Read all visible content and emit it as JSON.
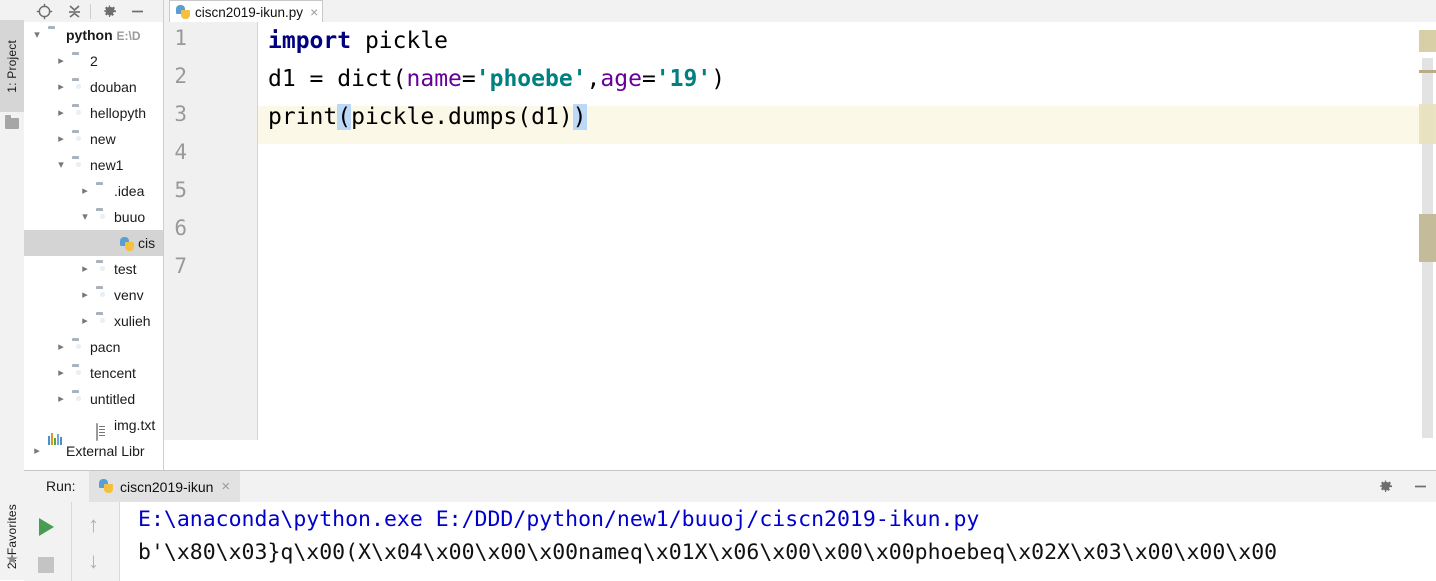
{
  "app": "PyCharm",
  "left_tool_strip": {
    "project_tab": {
      "label": "1: Project",
      "underline": "1",
      "icon": "folder-icon"
    },
    "favorites_tab": {
      "label": "2: Favorites",
      "underline": "2",
      "icon": "star-icon"
    }
  },
  "project_panel": {
    "toolbar": [
      {
        "name": "locate-icon",
        "title": "Select Opened File"
      },
      {
        "name": "collapse-all-icon",
        "title": "Collapse All"
      },
      {
        "name": "gear-icon",
        "title": "Settings"
      },
      {
        "name": "minimize-icon",
        "title": "Hide"
      }
    ],
    "tree": [
      {
        "label": "python",
        "detail": "E:\\D",
        "icon": "folder-icon",
        "depth": 0,
        "arrow": "down",
        "bold": true,
        "selected": false
      },
      {
        "label": "2",
        "detail": "",
        "icon": "folder-icon",
        "depth": 1,
        "arrow": "right",
        "bold": false,
        "selected": false
      },
      {
        "label": "douban",
        "detail": "",
        "icon": "folder-open-icon",
        "depth": 1,
        "arrow": "right",
        "bold": false,
        "selected": false
      },
      {
        "label": "hellopyth",
        "detail": "",
        "icon": "folder-open-icon",
        "depth": 1,
        "arrow": "right",
        "bold": false,
        "selected": false
      },
      {
        "label": "new",
        "detail": "",
        "icon": "folder-open-icon",
        "depth": 1,
        "arrow": "right",
        "bold": false,
        "selected": false
      },
      {
        "label": "new1",
        "detail": "",
        "icon": "folder-open-icon",
        "depth": 1,
        "arrow": "down",
        "bold": false,
        "selected": false
      },
      {
        "label": ".idea",
        "detail": "",
        "icon": "folder-icon",
        "depth": 2,
        "arrow": "right",
        "bold": false,
        "selected": false
      },
      {
        "label": "buuo",
        "detail": "",
        "icon": "folder-open-icon",
        "depth": 2,
        "arrow": "down",
        "bold": false,
        "selected": false
      },
      {
        "label": "cis",
        "detail": "",
        "icon": "python-file-icon",
        "depth": 3,
        "arrow": "",
        "bold": false,
        "selected": true
      },
      {
        "label": "test",
        "detail": "",
        "icon": "folder-open-icon",
        "depth": 2,
        "arrow": "right",
        "bold": false,
        "selected": false
      },
      {
        "label": "venv",
        "detail": "",
        "icon": "folder-open-icon",
        "depth": 2,
        "arrow": "right",
        "bold": false,
        "selected": false
      },
      {
        "label": "xulieh",
        "detail": "",
        "icon": "folder-open-icon",
        "depth": 2,
        "arrow": "right",
        "bold": false,
        "selected": false
      },
      {
        "label": "pacn",
        "detail": "",
        "icon": "folder-open-icon",
        "depth": 1,
        "arrow": "right",
        "bold": false,
        "selected": false
      },
      {
        "label": "tencent",
        "detail": "",
        "icon": "folder-open-icon",
        "depth": 1,
        "arrow": "right",
        "bold": false,
        "selected": false
      },
      {
        "label": "untitled",
        "detail": "",
        "icon": "folder-open-icon",
        "depth": 1,
        "arrow": "right",
        "bold": false,
        "selected": false
      },
      {
        "label": "img.txt",
        "detail": "",
        "icon": "text-file-icon",
        "depth": 2,
        "arrow": "",
        "bold": false,
        "selected": false
      },
      {
        "label": "External Libr",
        "detail": "",
        "icon": "library-icon",
        "depth": 0,
        "arrow": "right",
        "bold": false,
        "selected": false
      }
    ]
  },
  "editor": {
    "tabs": [
      {
        "label": "ciscn2019-ikun.py",
        "icon": "python-file-icon",
        "close": "×",
        "active": true
      }
    ],
    "line_numbers": [
      "1",
      "2",
      "3",
      "4",
      "5",
      "6",
      "7"
    ],
    "caret_line": 3,
    "lines": [
      {
        "n": 1,
        "tokens": [
          {
            "t": "import",
            "c": "kw"
          },
          {
            "t": " pickle",
            "c": "fn"
          }
        ]
      },
      {
        "n": 2,
        "tokens": [
          {
            "t": "d1 ",
            "c": "fn"
          },
          {
            "t": "=",
            "c": "op"
          },
          {
            "t": " dict(",
            "c": "fn"
          },
          {
            "t": "name",
            "c": "param"
          },
          {
            "t": "=",
            "c": "op"
          },
          {
            "t": "'phoebe'",
            "c": "str"
          },
          {
            "t": ",",
            "c": "op"
          },
          {
            "t": "age",
            "c": "param"
          },
          {
            "t": "=",
            "c": "op"
          },
          {
            "t": "'19'",
            "c": "str"
          },
          {
            "t": ")",
            "c": "fn"
          }
        ]
      },
      {
        "n": 3,
        "tokens": [
          {
            "t": "print",
            "c": "fn"
          },
          {
            "t": "(",
            "c": "brhl"
          },
          {
            "t": "pickle.dumps(d1)",
            "c": "fn"
          },
          {
            "t": ")",
            "c": "brhl"
          }
        ]
      }
    ]
  },
  "run_window": {
    "title": "Run:",
    "tab": {
      "label": "ciscn2019-ikun",
      "icon": "python-file-icon",
      "close": "×"
    },
    "toolbar": [
      {
        "name": "rerun-button",
        "icon": "play-icon"
      },
      {
        "name": "stop-button",
        "icon": "stop-icon"
      },
      {
        "name": "prev-occurrence-button",
        "icon": "arrow-up-icon",
        "glyph": "↑"
      },
      {
        "name": "next-occurrence-button",
        "icon": "arrow-down-icon",
        "glyph": "↓"
      }
    ],
    "header_actions": [
      {
        "name": "gear-icon",
        "title": "Settings"
      },
      {
        "name": "minimize-icon",
        "title": "Hide"
      }
    ],
    "console": [
      {
        "text": "E:\\anaconda\\python.exe E:/DDD/python/new1/buuoj/ciscn2019-ikun.py",
        "style": "cpath"
      },
      {
        "text": "b'\\x80\\x03}q\\x00(X\\x04\\x00\\x00\\x00nameq\\x01X\\x06\\x00\\x00\\x00phoebeq\\x02X\\x03\\x00\\x00\\x00",
        "style": "cout"
      }
    ]
  },
  "colors": {
    "keyword": "#000080",
    "string": "#008080",
    "param": "#660099",
    "console_path": "#0000cc",
    "caret_line_bg": "#fcf8e7",
    "selection_bracket": "#bcd8f7",
    "run_play": "#499c54"
  }
}
